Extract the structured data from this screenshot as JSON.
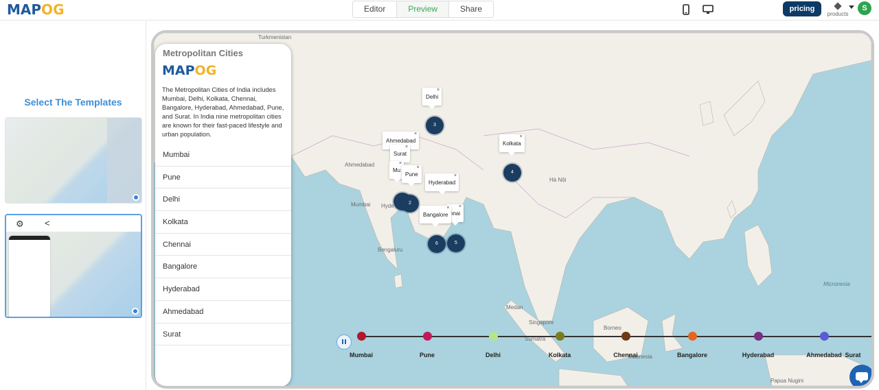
{
  "topbar": {
    "logo": {
      "pre": "MAP",
      "o1": "O",
      "o2": "G"
    },
    "tabs": [
      {
        "label": "Editor"
      },
      {
        "label": "Preview"
      },
      {
        "label": "Share"
      }
    ],
    "active_tab": "Preview",
    "pricing_label": "pricing",
    "products_label": "products",
    "avatar_initial": "S"
  },
  "left_panel": {
    "title": "Select The Templates"
  },
  "info_panel": {
    "title": "Metropolitan Cities",
    "logo": {
      "pre": "MAP",
      "o1": "O",
      "o2": "G"
    },
    "description": "The Metropolitan Cities of India includes Mumbai, Delhi, Kolkata, Chennai, Bangalore, Hyderabad, Ahmedabad, Pune, and Surat. In India nine metropolitan cities are known for their fast-paced lifestyle and urban population.",
    "items": [
      "Mumbai",
      "Pune",
      "Delhi",
      "Kolkata",
      "Chennai",
      "Bangalore",
      "Hyderabad",
      "Ahmedabad",
      "Surat"
    ]
  },
  "map": {
    "popups": [
      "Delhi",
      "Ahmedabad",
      "Surat",
      "Mu",
      "Pune",
      "Hyderabad",
      "Kolkata",
      "Bangalore",
      "nnai"
    ],
    "popup_close": "×",
    "clusters": [
      "3",
      "4",
      "2",
      "6",
      "5"
    ],
    "labels": {
      "turkmenistan": "Turkmenistan",
      "ahmedabad": "Ahmedabad",
      "mumbai": "Mumbai",
      "bengaluru": "Bengaluru",
      "hyderabad": "Hyde",
      "chennai": "Chennai",
      "ha_noi": "Hà Nội",
      "singapore": "Singapore",
      "medan": "Medan",
      "borneo": "Borneo",
      "indonesia": "Indonesia",
      "sumatra": "Sumatra",
      "micronesia": "Micronesia",
      "papua": "Papua Nugini"
    }
  },
  "timeline": {
    "stops": [
      {
        "label": "Mumbai",
        "color": "#b3172e"
      },
      {
        "label": "Pune",
        "color": "#c2185b"
      },
      {
        "label": "Delhi",
        "color": "#b5e48c"
      },
      {
        "label": "Kolkata",
        "color": "#7a7d1c"
      },
      {
        "label": "Chennai",
        "color": "#6d3b16"
      },
      {
        "label": "Bangalore",
        "color": "#e8631c"
      },
      {
        "label": "Hyderabad",
        "color": "#7b2d82"
      },
      {
        "label": "Ahmedabad",
        "color": "#5c5bd6"
      },
      {
        "label": "Surat",
        "color": "#4f4fd6"
      }
    ]
  }
}
